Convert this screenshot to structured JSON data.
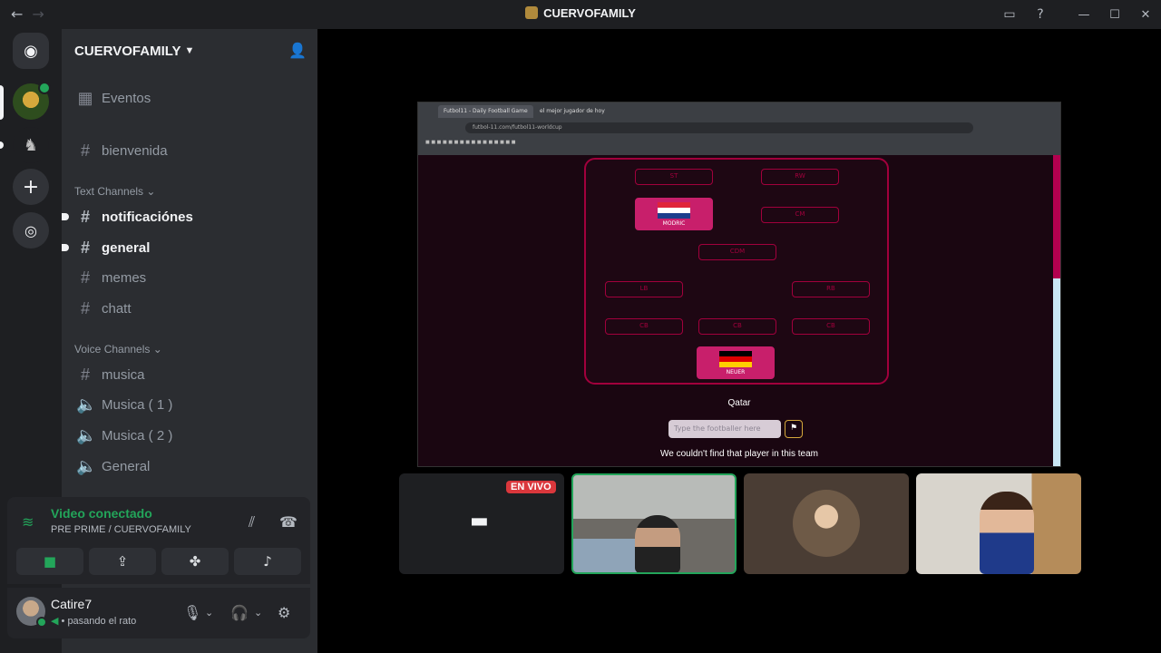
{
  "titlebar": {
    "title": "CUERVOFAMILY",
    "back": "←",
    "forward": "→"
  },
  "server_rail": {
    "home_icon": "discord-icon",
    "add_icon": "+",
    "discover_icon": "compass-icon"
  },
  "sidebar": {
    "guild_name": "CUERVOFAMILY",
    "channels_top": [
      {
        "label": "Eventos",
        "icon": "calendar-icon"
      },
      {
        "label": "bienvenida",
        "icon": "#"
      }
    ],
    "text_category": "Text Channels",
    "text_channels": [
      {
        "label": "notificaciónes",
        "unread": true
      },
      {
        "label": "general",
        "unread": true
      },
      {
        "label": "memes",
        "unread": false
      },
      {
        "label": "chatt",
        "unread": false
      }
    ],
    "voice_category": "Voice Channels",
    "voice_channels": [
      {
        "label": "musica",
        "icon": "#"
      },
      {
        "label": "Musica ( 1 )",
        "icon": "speaker-icon"
      },
      {
        "label": "Musica ( 2 )",
        "icon": "speaker-icon"
      },
      {
        "label": "General",
        "icon": "speaker-icon"
      }
    ]
  },
  "voice_panel": {
    "title": "Video conectado",
    "subtitle": "PRE PRIME",
    "server": "/ CUERVOFAMILY"
  },
  "user_panel": {
    "username": "Catire7",
    "status": "pasando el rato"
  },
  "screenshare": {
    "tab1": "Futbol11 - Daily Football Game",
    "tab2": "el mejor jugador de hoy",
    "url": "futbol-11.com/futbol11-worldcup",
    "slots": [
      "ST",
      "RW",
      "CM",
      "CDM",
      "LB",
      "RB",
      "CB",
      "CB",
      "CB"
    ],
    "filled_top_label": "MODRIC",
    "filled_bottom_label": "NEUER",
    "country": "Qatar",
    "input_placeholder": "Type the footballer here",
    "error": "We couldn't find that player in this team"
  },
  "tiles": {
    "live_label": "EN VIVO"
  },
  "colors": {
    "accent_green": "#23a55a",
    "live_red": "#da373c",
    "pitch_pink": "#a1003c"
  }
}
